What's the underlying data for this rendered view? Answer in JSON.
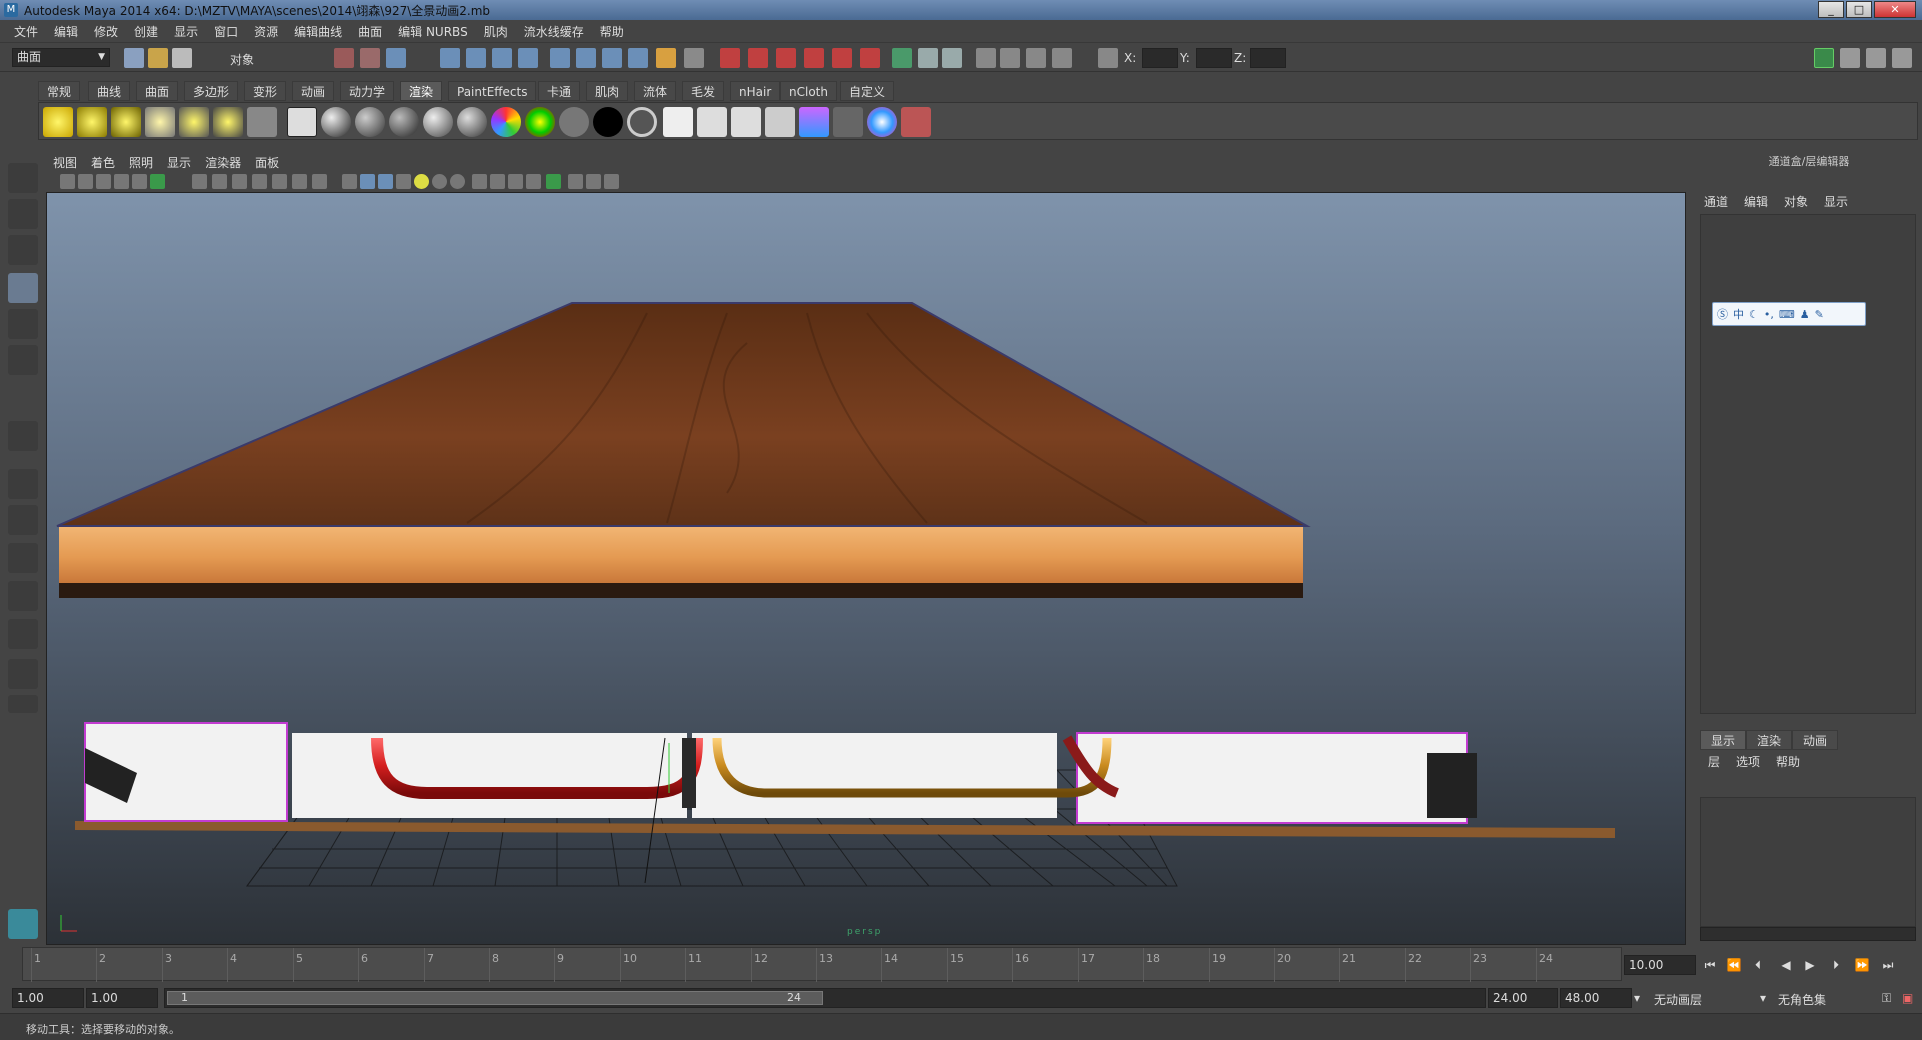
{
  "window": {
    "title": "Autodesk Maya 2014 x64: D:\\MZTV\\MAYA\\scenes\\2014\\翊森\\927\\全景动画2.mb",
    "buttons": [
      "_",
      "□",
      "✕"
    ]
  },
  "menubar": [
    "文件",
    "编辑",
    "修改",
    "创建",
    "显示",
    "窗口",
    "资源",
    "编辑曲线",
    "曲面",
    "编辑 NURBS",
    "肌肉",
    "流水线缓存",
    "帮助"
  ],
  "statusline": {
    "mode": "曲面",
    "object_label": "对象",
    "x_label": "X:",
    "y_label": "Y:",
    "z_label": "Z:"
  },
  "shelf_tabs": [
    "常规",
    "曲线",
    "曲面",
    "多边形",
    "变形",
    "动画",
    "动力学",
    "渲染",
    "PaintEffects",
    "卡通",
    "肌肉",
    "流体",
    "毛发",
    "nHair",
    "nCloth",
    "自定义"
  ],
  "active_shelf_tab": "渲染",
  "viewport": {
    "menu": [
      "视图",
      "着色",
      "照明",
      "显示",
      "渲染器",
      "面板"
    ],
    "camera_label": "persp"
  },
  "right_panel": {
    "title": "通道盒/层编辑器",
    "menu": [
      "通道",
      "编辑",
      "对象",
      "显示"
    ],
    "ime_items": [
      "中"
    ],
    "layer_tabs": [
      "显示",
      "渲染",
      "动画"
    ],
    "layer_menu": [
      "层",
      "选项",
      "帮助"
    ]
  },
  "time_slider": {
    "ticks": [
      "1",
      "2",
      "3",
      "4",
      "5",
      "6",
      "7",
      "8",
      "9",
      "10",
      "11",
      "12",
      "13",
      "14",
      "15",
      "16",
      "17",
      "18",
      "19",
      "20",
      "21",
      "22",
      "23",
      "24"
    ],
    "current_time": "10.00"
  },
  "range_slider": {
    "start": "1.00",
    "playback_start": "1.00",
    "range_min_label": "1",
    "range_max_label": "24",
    "playback_end": "24.00",
    "end": "48.00",
    "anim_layer": "无动画层",
    "char_set": "无角色集"
  },
  "help_line": "移动工具：选择要移动的对象。",
  "colors": {
    "viewport_top": "#7f93ab",
    "viewport_bottom": "#2c3137",
    "wood_top": "#6b3a1c",
    "wood_edge": "#e8a05a",
    "red_pipe": "#d41e1e",
    "yellow_pipe": "#c98a1e"
  }
}
